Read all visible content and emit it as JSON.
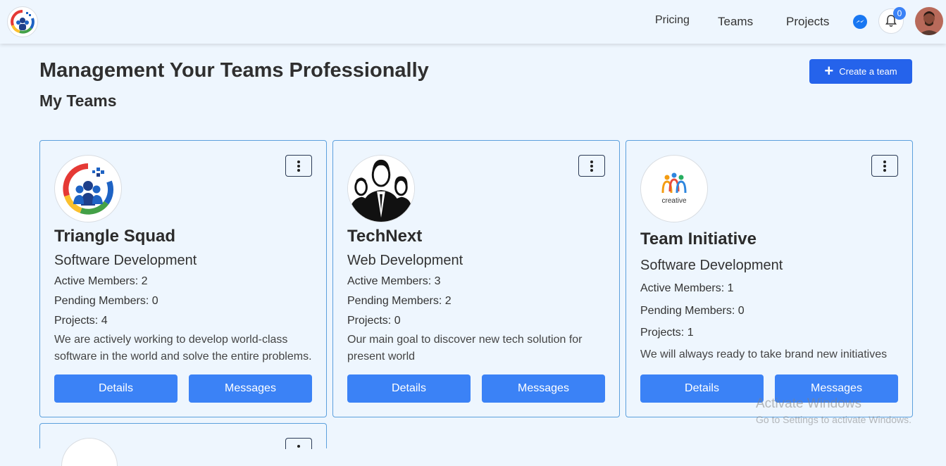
{
  "nav": {
    "links": [
      "Pricing",
      "Teams",
      "Projects"
    ],
    "notification_count": "0"
  },
  "header": {
    "title": "Management Your Teams Professionally",
    "section": "My Teams",
    "create_label": "Create a team"
  },
  "teams": [
    {
      "name": "Triangle Squad",
      "category": "Software Development",
      "active": "Active Members: 2",
      "pending": "Pending Members: 0",
      "projects": "Projects: 4",
      "description": "We are actively working to develop world-class software in the world and solve the entire problems.",
      "details_label": "Details",
      "messages_label": "Messages"
    },
    {
      "name": "TechNext",
      "category": "Web Development",
      "active": "Active Members: 3",
      "pending": "Pending Members: 2",
      "projects": "Projects: 0",
      "description": "Our main goal to discover new tech solution for present world",
      "details_label": "Details",
      "messages_label": "Messages"
    },
    {
      "name": "Team Initiative",
      "category": "Software Development",
      "active": "Active Members: 1",
      "pending": "Pending Members: 0",
      "projects": "Projects: 1",
      "description": "We will always ready to take brand new initiatives",
      "details_label": "Details",
      "messages_label": "Messages",
      "logo_text": "creative"
    }
  ],
  "watermark": {
    "line1": "Activate Windows",
    "line2": "Go to Settings to activate Windows."
  },
  "colors": {
    "accent": "#3b82f6",
    "primary_button": "#2563eb",
    "background": "#eef6fe",
    "card_border": "#5ca0dd"
  }
}
